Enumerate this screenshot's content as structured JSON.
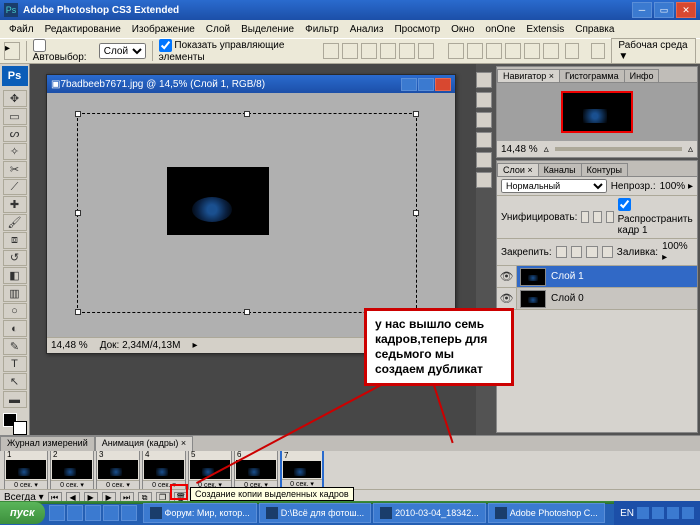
{
  "titlebar": {
    "app_icon": "Ps",
    "title": "Adobe Photoshop CS3 Extended"
  },
  "menus": [
    "Файл",
    "Редактирование",
    "Изображение",
    "Слой",
    "Выделение",
    "Фильтр",
    "Анализ",
    "Просмотр",
    "Окно",
    "onOne",
    "Extensis",
    "Справка"
  ],
  "options": {
    "auto_select_label": "Автовыбор:",
    "auto_select_target": "Слой",
    "show_controls_label": "Показать управляющие элементы",
    "workspace_label": "Рабочая среда ▼"
  },
  "document": {
    "title": "7badbeeb7671.jpg @ 14,5% (Слой 1, RGB/8)",
    "zoom": "14,48 %",
    "doc_info": "Док: 2,34M/4,13M"
  },
  "navigator": {
    "tabs": [
      "Навигатор ×",
      "Гистограмма",
      "Инфо"
    ],
    "zoom": "14,48 %"
  },
  "layers_panel": {
    "tabs": [
      "Слои ×",
      "Каналы",
      "Контуры"
    ],
    "blend": "Нормальный",
    "opacity_label": "Непрозр.:",
    "opacity": "100% ▸",
    "unify_label": "Унифицировать:",
    "propagate_label": "Распространить кадр 1",
    "lock_label": "Закрепить:",
    "fill_label": "Заливка:",
    "fill": "100% ▸",
    "layers": [
      {
        "name": "Слой 1",
        "selected": true
      },
      {
        "name": "Слой 0",
        "selected": false
      }
    ]
  },
  "animation": {
    "tabs": [
      "Журнал измерений",
      "Анимация (кадры) ×"
    ],
    "frames": [
      {
        "n": "1",
        "t": "0 сек. ▾"
      },
      {
        "n": "2",
        "t": "0 сек. ▾"
      },
      {
        "n": "3",
        "t": "0 сек. ▾"
      },
      {
        "n": "4",
        "t": "0 сек. ▾"
      },
      {
        "n": "5",
        "t": "0 сек. ▾"
      },
      {
        "n": "6",
        "t": "0 сек. ▾"
      },
      {
        "n": "7",
        "t": "0 сек. ▾"
      }
    ],
    "loop": "Всегда ▾",
    "tooltip": "Создание копии выделенных кадров"
  },
  "annotation": {
    "text": "у нас вышло семь кадров,теперь для седьмого мы создаем дубликат"
  },
  "taskbar": {
    "start": "пуск",
    "tasks": [
      "Форум: Мир, котор...",
      "D:\\Всё для фотош...",
      "2010-03-04_18342...",
      "Adobe Photoshop C..."
    ],
    "lang": "EN"
  }
}
